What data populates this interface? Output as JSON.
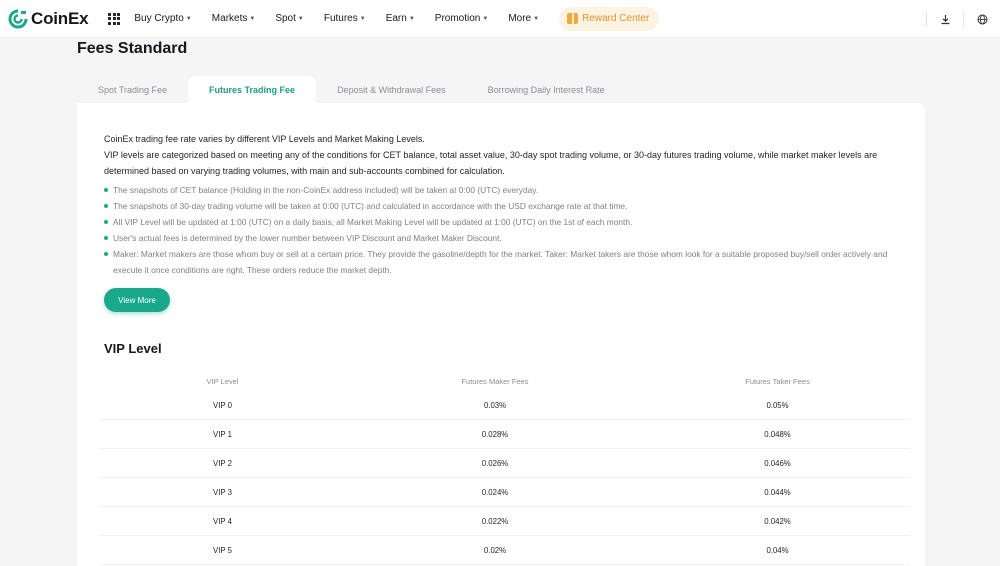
{
  "nav": {
    "brand": "CoinEx",
    "menu": [
      {
        "label": "Buy Crypto",
        "name": "buy-crypto"
      },
      {
        "label": "Markets",
        "name": "markets"
      },
      {
        "label": "Spot",
        "name": "spot"
      },
      {
        "label": "Futures",
        "name": "futures"
      },
      {
        "label": "Earn",
        "name": "earn"
      },
      {
        "label": "Promotion",
        "name": "promotion"
      },
      {
        "label": "More",
        "name": "more"
      }
    ],
    "reward_label": "Reward Center",
    "colors": {
      "brand": "#1aa88d",
      "reward": "#e0932d"
    },
    "icons": {
      "download": "download-icon",
      "globe": "globe-icon",
      "apps": "apps-grid-icon"
    }
  },
  "page": {
    "title": "Fees Standard",
    "tabs": [
      {
        "label": "Spot Trading Fee",
        "active": false
      },
      {
        "label": "Futures Trading Fee",
        "active": true
      },
      {
        "label": "Deposit & Withdrawal Fees",
        "active": false
      },
      {
        "label": "Borrowing Daily Interest Rate",
        "active": false
      }
    ]
  },
  "intro": {
    "line1": "CoinEx trading fee rate varies by different VIP Levels and Market Making Levels.",
    "line2": "VIP levels are categorized based on meeting any of the conditions for CET balance, total asset value, 30-day spot trading volume, or 30-day futures trading volume, while market maker levels are determined based on varying trading volumes, with main and sub-accounts combined for calculation."
  },
  "bullets": [
    "The snapshots of CET balance (Holding in the non-CoinEx address included) will be taken at 0:00 (UTC) everyday.",
    "The snapshots of 30-day trading volume will be taken at 0:00 (UTC) and calculated in accordance with the USD exchange rate at that time.",
    "All VIP Level will be updated at 1:00 (UTC) on a daily basis, all Market Making Level will be updated at 1:00 (UTC) on the 1st of each month.",
    "User's actual fees is determined by the lower number between VIP Discount and Market Maker Discount.",
    "Maker: Market makers are those whom buy or sell at a certain price. They provide the gasoline/depth for the market. Taker: Market takers are those whom look for a suitable proposed buy/sell order actively and execute it once conditions are right. These orders reduce the market depth."
  ],
  "view_more": "View More",
  "vip": {
    "title": "VIP Level",
    "headers": [
      "VIP Level",
      "Futures Maker Fees",
      "Futures Taker Fees"
    ],
    "rows": [
      [
        "VIP 0",
        "0.03%",
        "0.05%"
      ],
      [
        "VIP 1",
        "0.028%",
        "0.048%"
      ],
      [
        "VIP 2",
        "0.026%",
        "0.046%"
      ],
      [
        "VIP 3",
        "0.024%",
        "0.044%"
      ],
      [
        "VIP 4",
        "0.022%",
        "0.042%"
      ],
      [
        "VIP 5",
        "0.02%",
        "0.04%"
      ]
    ]
  }
}
